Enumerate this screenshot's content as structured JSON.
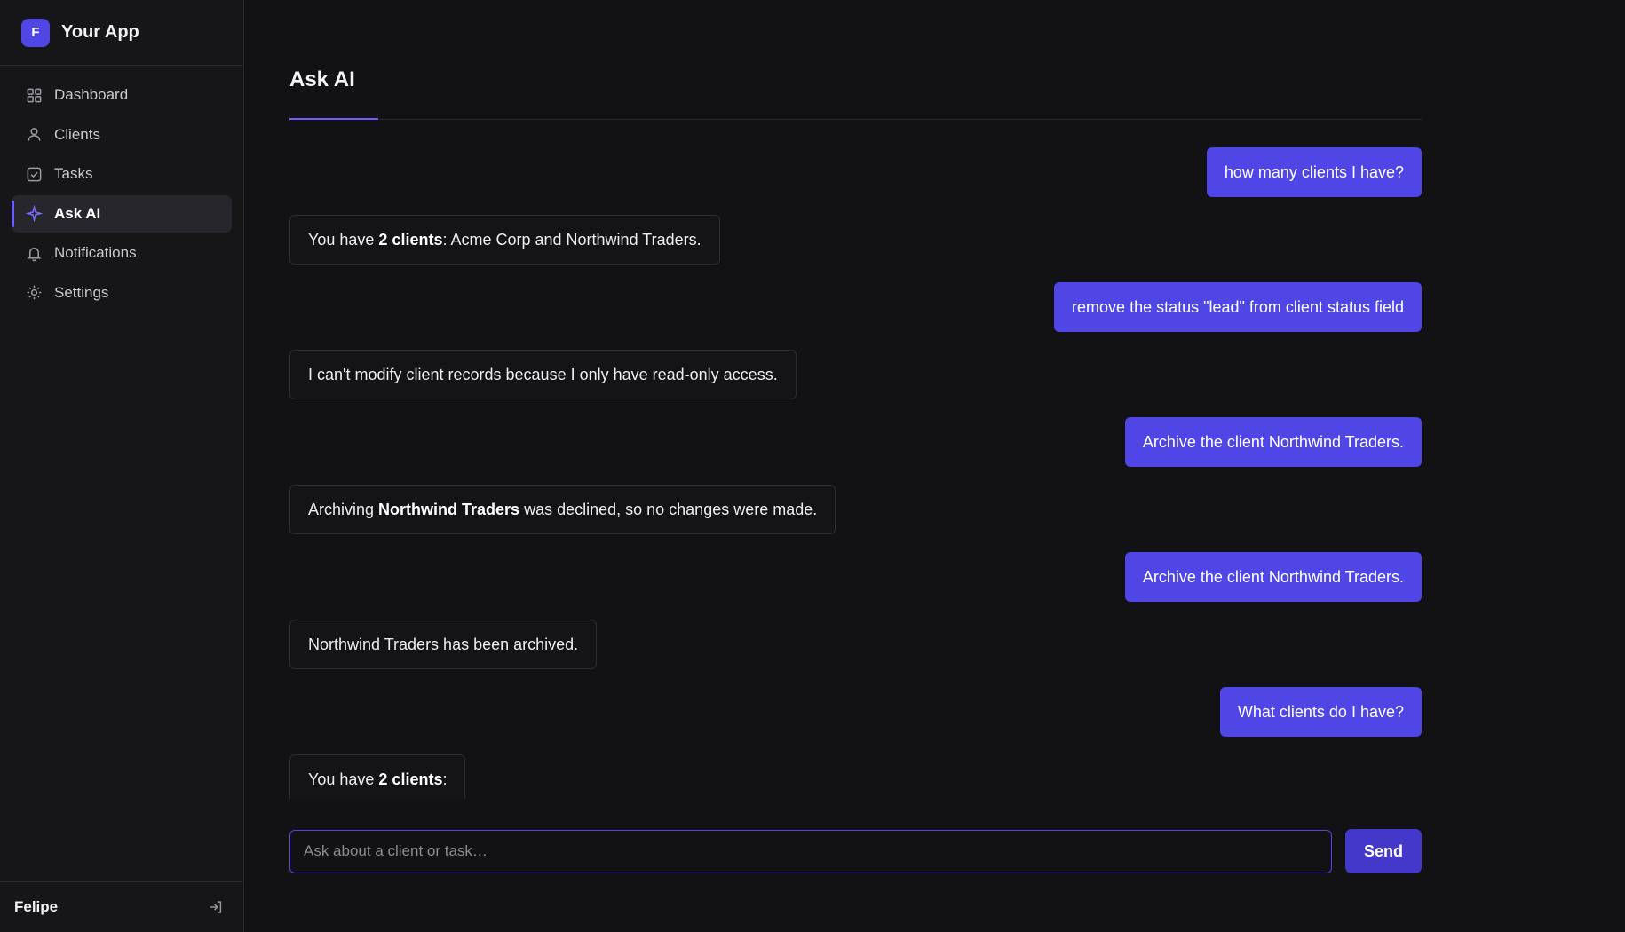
{
  "app": {
    "logo_letter": "F",
    "name": "Your App"
  },
  "sidebar": {
    "items": [
      {
        "label": "Dashboard",
        "icon": "grid-icon"
      },
      {
        "label": "Clients",
        "icon": "user-icon"
      },
      {
        "label": "Tasks",
        "icon": "checkbox-icon"
      },
      {
        "label": "Ask AI",
        "icon": "sparkle-icon",
        "active": true
      },
      {
        "label": "Notifications",
        "icon": "bell-icon"
      },
      {
        "label": "Settings",
        "icon": "gear-icon"
      }
    ],
    "user_name": "Felipe",
    "logout_icon": "logout-icon"
  },
  "main": {
    "title": "Ask AI",
    "messages": [
      {
        "role": "user",
        "text": "how many clients I have?"
      },
      {
        "role": "ai",
        "parts": [
          "You have ",
          "2 clients",
          ": Acme Corp and Northwind Traders."
        ]
      },
      {
        "role": "user",
        "text": "remove the status \"lead\" from client status field"
      },
      {
        "role": "ai",
        "parts": [
          "I can't modify client records because I only have read-only access."
        ]
      },
      {
        "role": "user",
        "text": "Archive the client Northwind Traders."
      },
      {
        "role": "ai",
        "parts": [
          "Archiving ",
          "Northwind Traders",
          " was declined, so no changes were made."
        ]
      },
      {
        "role": "user",
        "text": "Archive the client Northwind Traders."
      },
      {
        "role": "ai",
        "parts": [
          "Northwind Traders has been archived."
        ]
      },
      {
        "role": "user",
        "text": "What clients do I have?"
      },
      {
        "role": "ai",
        "parts": [
          "You have ",
          "2 clients",
          ":"
        ]
      }
    ],
    "input": {
      "value": "",
      "placeholder": "Ask about a client or task…"
    },
    "send_label": "Send"
  },
  "colors": {
    "accent": "#4f46e5",
    "accent_bar": "#6d5dfc",
    "background": "#121214",
    "sidebar_bg": "#161619"
  }
}
